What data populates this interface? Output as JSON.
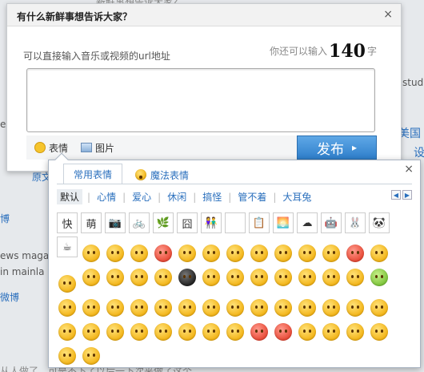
{
  "background": {
    "lines": [
      {
        "text": "新鲜事想告诉大家？",
        "kind": "text"
      },
      {
        "text": "studi",
        "kind": "text"
      },
      {
        "text": "美国",
        "kind": "link"
      },
      {
        "text": "设",
        "kind": "link"
      },
      {
        "text": "es",
        "kind": "text"
      },
      {
        "text": "原文转发",
        "kind": "link"
      },
      {
        "text": "博",
        "kind": "link"
      },
      {
        "text": "ews maga",
        "kind": "text"
      },
      {
        "text": "in mainla",
        "kind": "text"
      },
      {
        "text": "微博",
        "kind": "link"
      },
      {
        "text": "从人做了。可是不下了以后一下次来做了这个",
        "kind": "text"
      }
    ]
  },
  "publish": {
    "title": "有什么新鲜事想告诉大家？",
    "close": "×",
    "hint": "可以直接输入音乐或视频的url地址",
    "counter_prefix": "你还可以输入",
    "counter_value": "140",
    "counter_suffix": "字",
    "emoticon_label": "表情",
    "image_label": "图片",
    "send_label": "发布",
    "send_arrow": "▸"
  },
  "emoticon_panel": {
    "close": "×",
    "tabs": [
      {
        "label": "常用表情",
        "active": true
      },
      {
        "label": "魔法表情",
        "active": false
      }
    ],
    "categories": [
      "默认",
      "心情",
      "爱心",
      "休闲",
      "搞怪",
      "管不着",
      "大耳兔"
    ],
    "selected_category": "默认",
    "pager_prev": "◀",
    "pager_next": "▶",
    "stickers": [
      "快",
      "萌",
      "📷",
      "🚲",
      "🌿",
      "囧",
      "👫",
      "",
      "📋",
      "🌅",
      "☁",
      "🤖",
      "🐰",
      "🐼",
      "☕"
    ],
    "icons": [
      "smile",
      "laugh",
      "tongue",
      "love",
      "shy",
      "cry",
      "awkward",
      "sweat",
      "snort",
      "yawn",
      "grin",
      "angry",
      "bored",
      "blush",
      "money",
      "shock",
      "thinking",
      "cool",
      "dizzy",
      "surprise",
      "smirk",
      "sleepy",
      "confused",
      "kiss",
      "think",
      "shh",
      "sick",
      "pouting",
      "hmm",
      "clap",
      "doubt",
      "wink",
      "disappointed",
      "worried",
      "anxious",
      "cry2",
      "crazy",
      "hug",
      "question",
      "laugh2",
      "handshake",
      "victory",
      "thumbs-up",
      "thumbs-down",
      "yeah",
      "ok",
      "good",
      "come",
      "cake",
      "heart",
      "broken-heart",
      "clock",
      "pig",
      "mic",
      "moon",
      "sun",
      "rain"
    ]
  }
}
